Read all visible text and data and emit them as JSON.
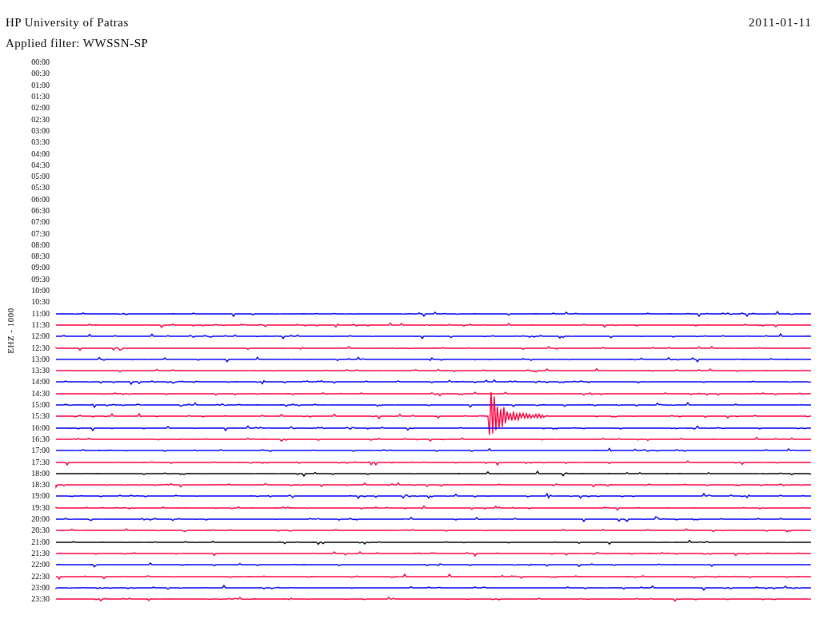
{
  "header": {
    "station": "HP University of Patras",
    "date": "2011-01-11",
    "filter": "Applied filter: WWSSN-SP"
  },
  "channel_label": "EHZ - 1000",
  "rows": [
    {
      "time": "00:00"
    },
    {
      "time": "00:30"
    },
    {
      "time": "01:00"
    },
    {
      "time": "01:30"
    },
    {
      "time": "02:00"
    },
    {
      "time": "02:30"
    },
    {
      "time": "03:00"
    },
    {
      "time": "03:30"
    },
    {
      "time": "04:00"
    },
    {
      "time": "04:30"
    },
    {
      "time": "05:00"
    },
    {
      "time": "05:30"
    },
    {
      "time": "06:00"
    },
    {
      "time": "06:30"
    },
    {
      "time": "07:00"
    },
    {
      "time": "07:30"
    },
    {
      "time": "08:00"
    },
    {
      "time": "08:30"
    },
    {
      "time": "09:00"
    },
    {
      "time": "09:30"
    },
    {
      "time": "10:00"
    },
    {
      "time": "10:30"
    },
    {
      "time": "11:00",
      "color": "#0000ff"
    },
    {
      "time": "11:30",
      "color": "#ff0040"
    },
    {
      "time": "12:00",
      "color": "#0000ff"
    },
    {
      "time": "12:30",
      "color": "#ff0040"
    },
    {
      "time": "13:00",
      "color": "#0000ff"
    },
    {
      "time": "13:30",
      "color": "#ff0040"
    },
    {
      "time": "14:00",
      "color": "#0000ff"
    },
    {
      "time": "14:30",
      "color": "#ff0040"
    },
    {
      "time": "15:00",
      "color": "#0000ff"
    },
    {
      "time": "15:30",
      "color": "#ff0040"
    },
    {
      "time": "16:00",
      "color": "#0000ff"
    },
    {
      "time": "16:30",
      "color": "#ff0040"
    },
    {
      "time": "17:00",
      "color": "#0000ff"
    },
    {
      "time": "17:30",
      "color": "#ff0040"
    },
    {
      "time": "18:00",
      "color": "#000000"
    },
    {
      "time": "18:30",
      "color": "#ff0040"
    },
    {
      "time": "19:00",
      "color": "#0000ff"
    },
    {
      "time": "19:30",
      "color": "#ff0040"
    },
    {
      "time": "20:00",
      "color": "#0000ff"
    },
    {
      "time": "20:30",
      "color": "#ff0040"
    },
    {
      "time": "21:00",
      "color": "#000000"
    },
    {
      "time": "21:30",
      "color": "#ff0040"
    },
    {
      "time": "22:00",
      "color": "#0000ff"
    },
    {
      "time": "22:30",
      "color": "#ff0040"
    },
    {
      "time": "23:00",
      "color": "#0000ff"
    },
    {
      "time": "23:30",
      "color": "#ff0040"
    }
  ]
}
